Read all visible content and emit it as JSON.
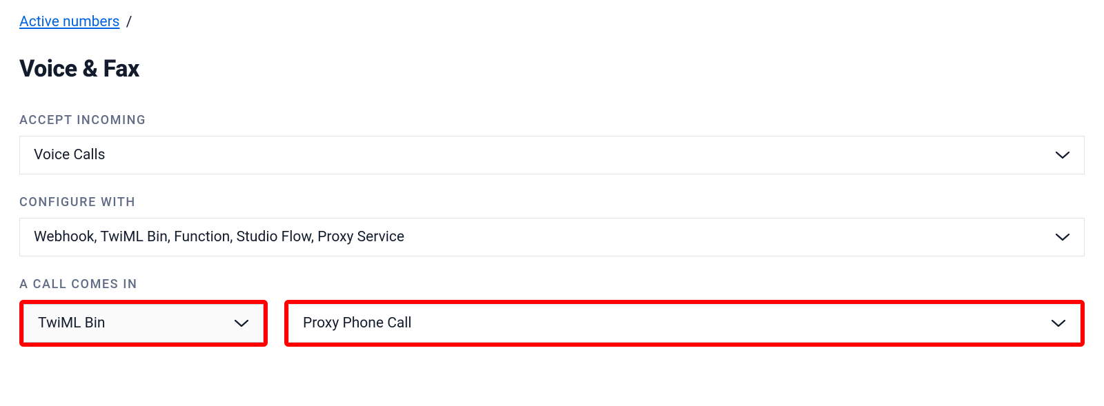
{
  "breadcrumb": {
    "link_label": "Active numbers",
    "separator": "/"
  },
  "page_title": "Voice & Fax",
  "fields": {
    "accept_incoming": {
      "label": "ACCEPT INCOMING",
      "value": "Voice Calls"
    },
    "configure_with": {
      "label": "CONFIGURE WITH",
      "value": "Webhook, TwiML Bin, Function, Studio Flow, Proxy Service"
    },
    "call_comes_in": {
      "label": "A CALL COMES IN",
      "handler_value": "TwiML Bin",
      "target_value": "Proxy Phone Call"
    }
  },
  "colors": {
    "link": "#0263e0",
    "text": "#121c2d",
    "label": "#606b85",
    "border": "#e1e3ea",
    "highlight": "#ff0000"
  }
}
